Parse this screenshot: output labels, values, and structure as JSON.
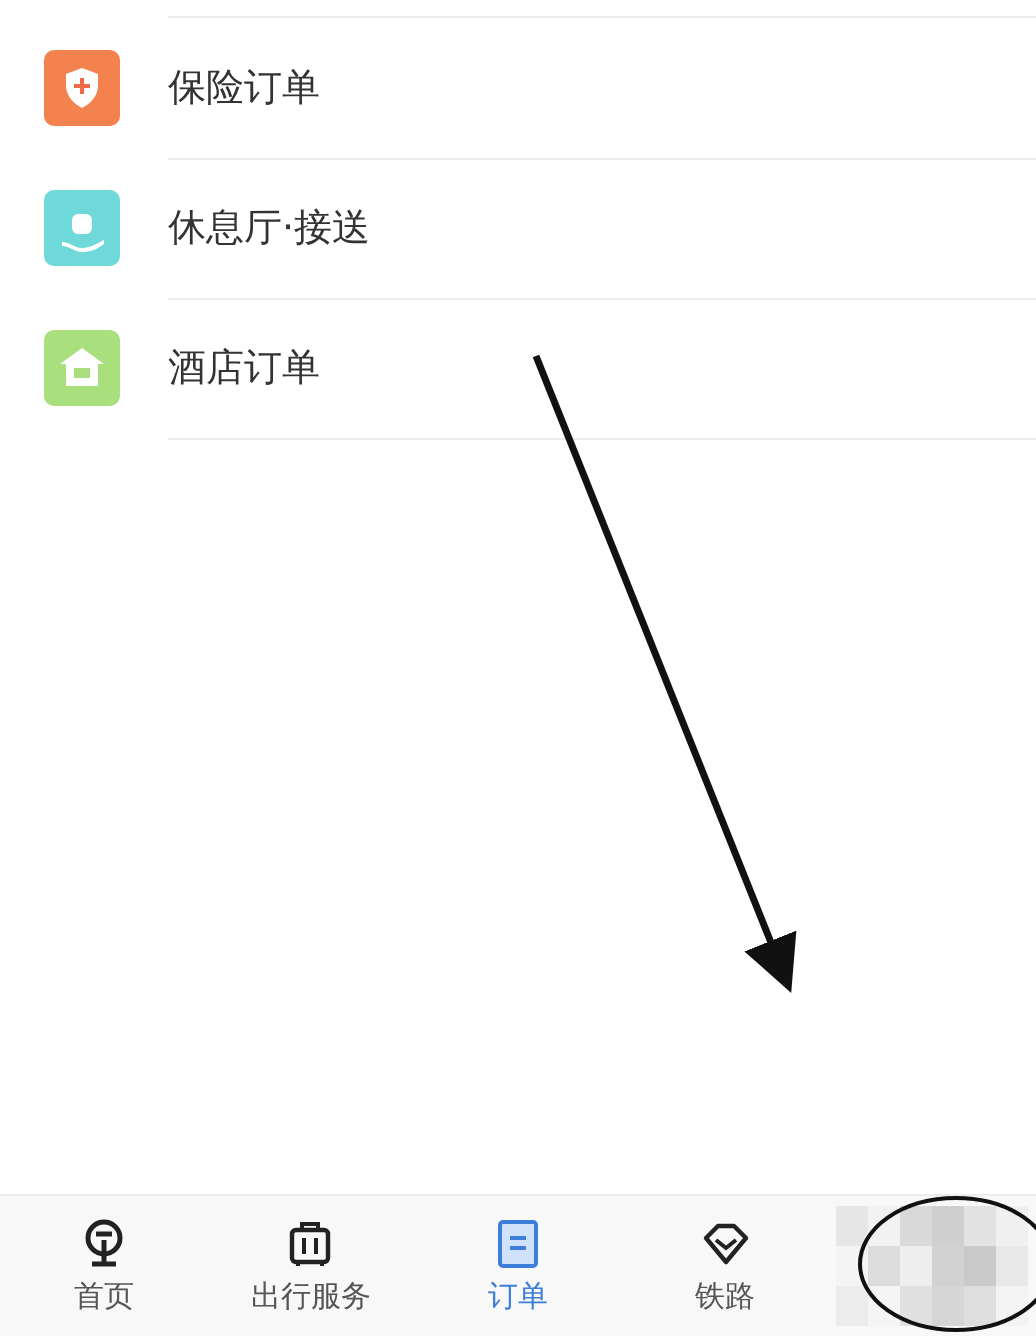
{
  "order_list": [
    {
      "label": "保险订单",
      "kind": "insurance"
    },
    {
      "label": "休息厅·接送",
      "kind": "lounge"
    },
    {
      "label": "酒店订单",
      "kind": "hotel"
    }
  ],
  "tab_bar": [
    {
      "label": "首页",
      "kind": "home",
      "selected": false
    },
    {
      "label": "出行服务",
      "kind": "luggage",
      "selected": false
    },
    {
      "label": "订单",
      "kind": "order",
      "selected": true
    },
    {
      "label": "铁路",
      "kind": "gem",
      "selected": false
    },
    {
      "kind": "hidden",
      "selected": false
    }
  ]
}
